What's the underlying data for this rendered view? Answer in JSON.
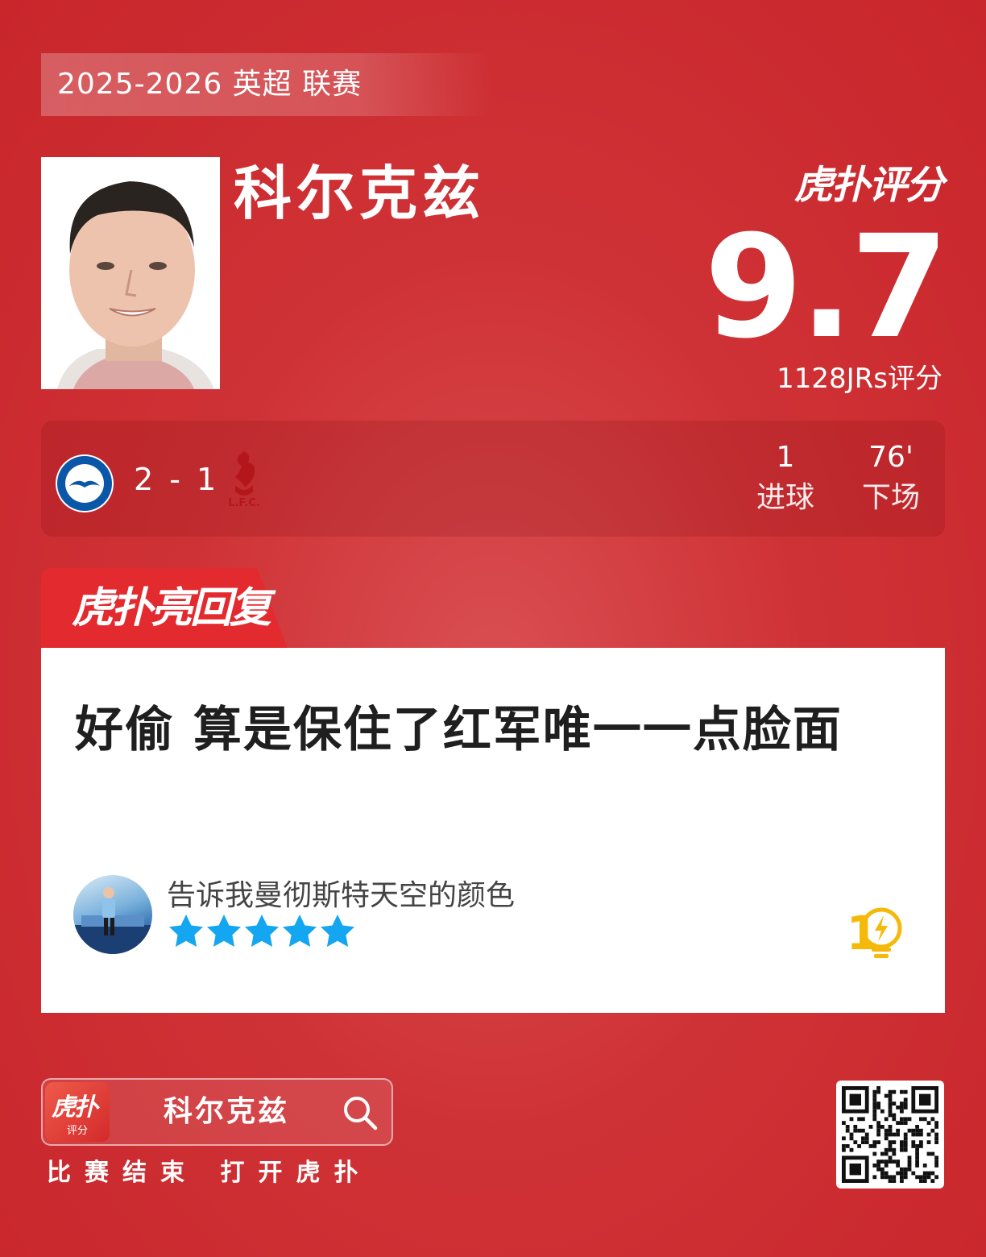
{
  "season_banner": "2025-2026 英超 联赛",
  "player": {
    "name": "科尔克兹"
  },
  "rating": {
    "brand": "虎扑评分",
    "score": "9.7",
    "votes_label": "1128JRs评分"
  },
  "match": {
    "home_club_icon": "brighton-crest-icon",
    "away_club_icon": "liverpool-crest-icon",
    "score": "2 - 1",
    "stats": [
      {
        "value": "1",
        "label": "进球"
      },
      {
        "value": "76'",
        "label": "下场"
      }
    ]
  },
  "reply": {
    "tab_label": "虎扑亮回复",
    "comment": "好偷 算是保住了红军唯一一点脸面",
    "username": "告诉我曼彻斯特天空的颜色",
    "stars": 5,
    "star_color": "#14a6f0",
    "light_count": "1",
    "light_color": "#f5b90a"
  },
  "footer": {
    "app_icon_text": "虎扑",
    "app_icon_sub": "评分",
    "search_text": "科尔克兹",
    "tagline": "比赛结束 打开虎扑"
  },
  "colors": {
    "background": "#cf3236",
    "tab": "#e32a2f"
  }
}
